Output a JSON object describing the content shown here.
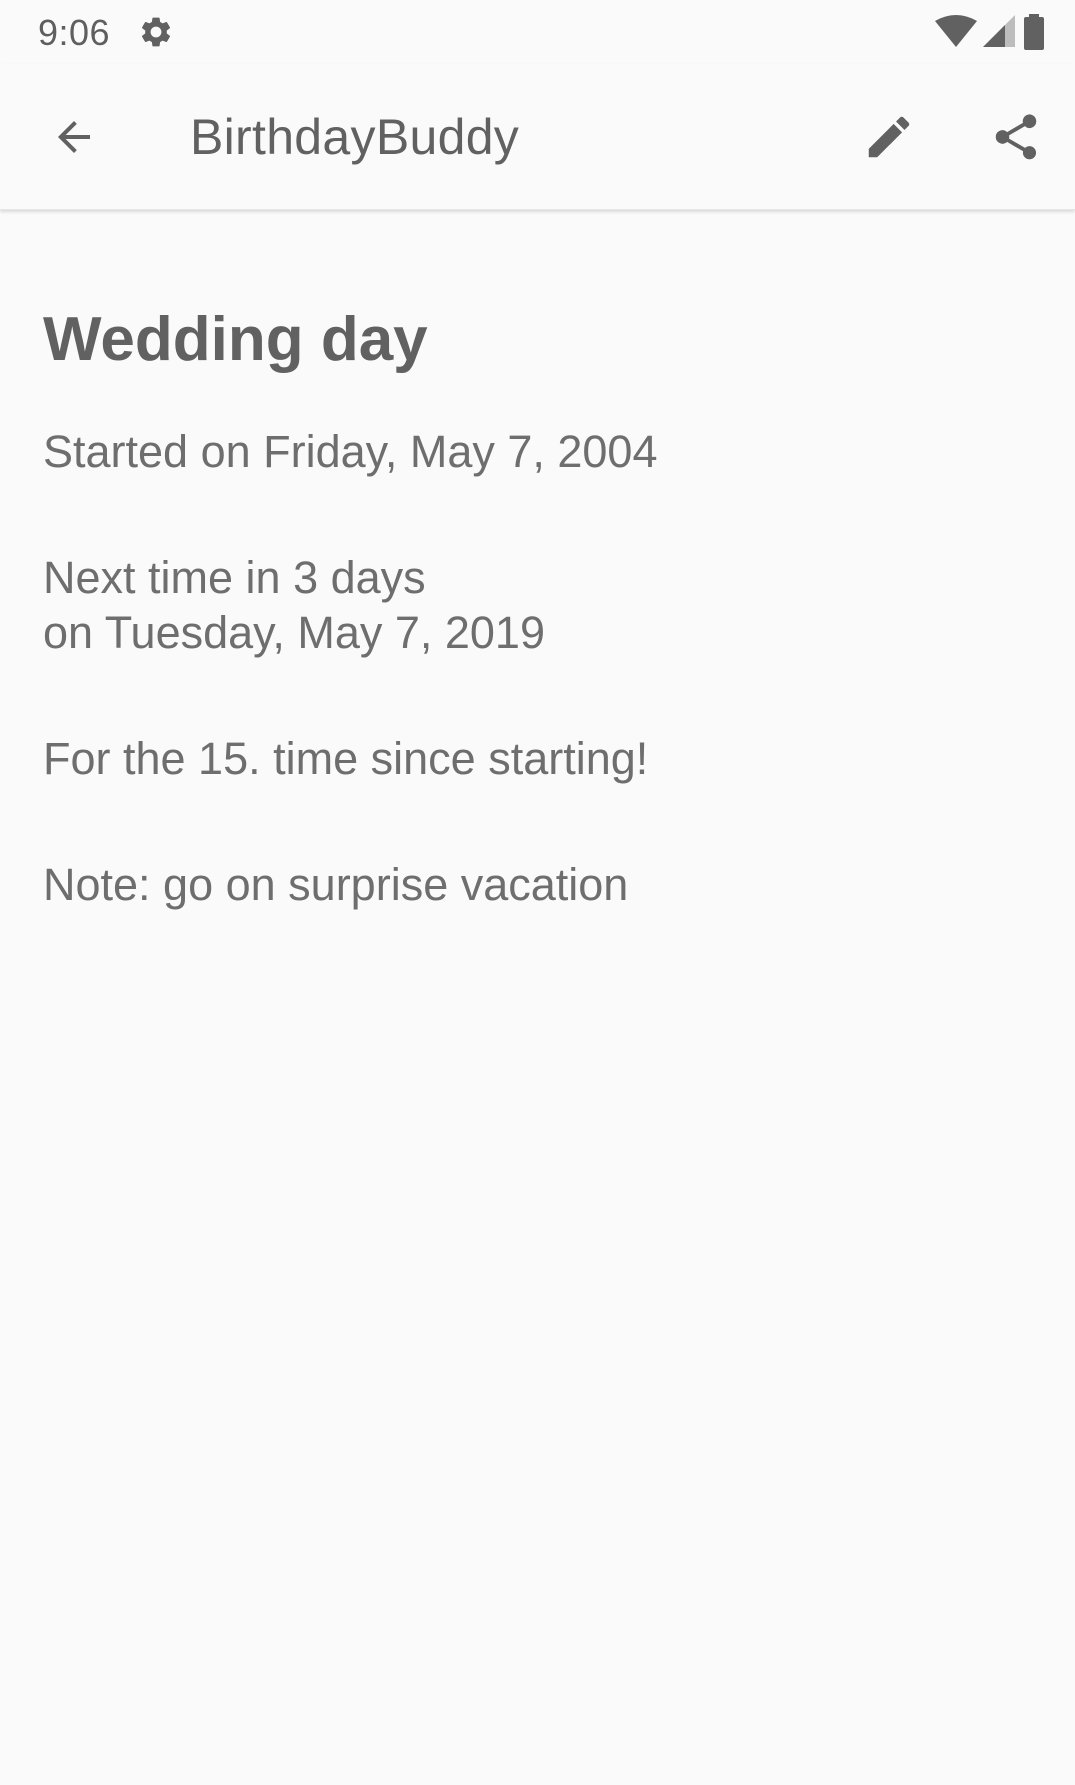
{
  "status_bar": {
    "time": "9:06",
    "icons": [
      "settings-icon",
      "wifi-icon",
      "signal-icon",
      "battery-icon"
    ]
  },
  "app_bar": {
    "title": "BirthdayBuddy",
    "back_icon": "arrow-back-icon",
    "edit_icon": "pencil-icon",
    "share_icon": "share-icon"
  },
  "event": {
    "title": "Wedding day",
    "started": "Started on Friday, May 7, 2004",
    "next_line1": "Next time in 3 days",
    "next_line2": "on Tuesday, May 7, 2019",
    "occurrence": "For the 15. time since starting!",
    "note": "Note: go on surprise vacation"
  },
  "colors": {
    "background": "#fafafa",
    "text_primary": "#616161",
    "text_secondary": "#6e6e6e",
    "icon": "#616161"
  }
}
